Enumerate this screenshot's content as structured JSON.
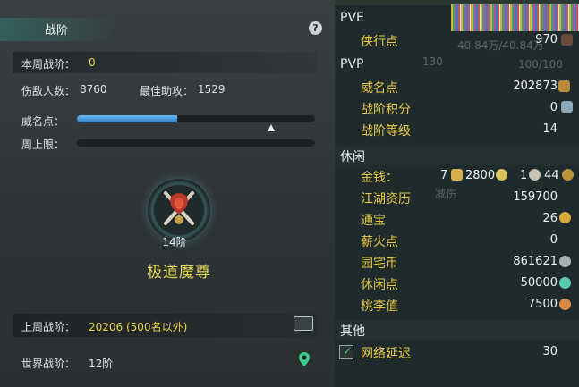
{
  "left": {
    "title": "战阶",
    "help": "?",
    "this_week_label": "本周战阶：",
    "this_week_value": "0",
    "enemies_label": "伤敌人数：",
    "enemies_value": "8760",
    "best_assist_label": "最佳助攻：",
    "best_assist_value": "1529",
    "prestige_label": "威名点：",
    "prestige_progress": 0.42,
    "weekly_cap_label": "周上限：",
    "weekly_cap_progress": 0,
    "rank_level": "14阶",
    "rank_name": "极道魔尊",
    "last_week_label": "上周战阶：",
    "last_week_value": "20206 (500名以外)",
    "world_label": "世界战阶：",
    "world_value": "12阶"
  },
  "right": {
    "pve": {
      "title": "PVE",
      "items": [
        {
          "label": "侠行点",
          "value": "970"
        }
      ]
    },
    "pvp": {
      "title": "PVP",
      "items": [
        {
          "label": "威名点",
          "value": "202873"
        },
        {
          "label": "战阶积分",
          "value": "0"
        },
        {
          "label": "战阶等级",
          "value": "14"
        }
      ]
    },
    "leisure": {
      "title": "休闲",
      "money_label": "金钱：",
      "money_gold": "7",
      "money_silver": "2800",
      "money_copper1": "1",
      "money_copper2": "44",
      "items": [
        {
          "label": "江湖资历",
          "value": "159700"
        },
        {
          "label": "通宝",
          "value": "26"
        },
        {
          "label": "薪火点",
          "value": "0"
        },
        {
          "label": "园宅币",
          "value": "861621"
        },
        {
          "label": "休闲点",
          "value": "50000"
        },
        {
          "label": "桃李值",
          "value": "7500"
        }
      ]
    },
    "other": {
      "title": "其他",
      "items": [
        {
          "label": "网络延迟",
          "value": "30"
        }
      ]
    },
    "ghost_texts": {
      "hp": "40.84万/40.84万",
      "stamina": "100/100",
      "lvl": "130",
      "debuff": "减伤"
    }
  },
  "colors": {
    "label_gold": "#e7cc4a",
    "rank_yellow": "#e7dd57",
    "bar_blue": "#3a8fd8"
  }
}
